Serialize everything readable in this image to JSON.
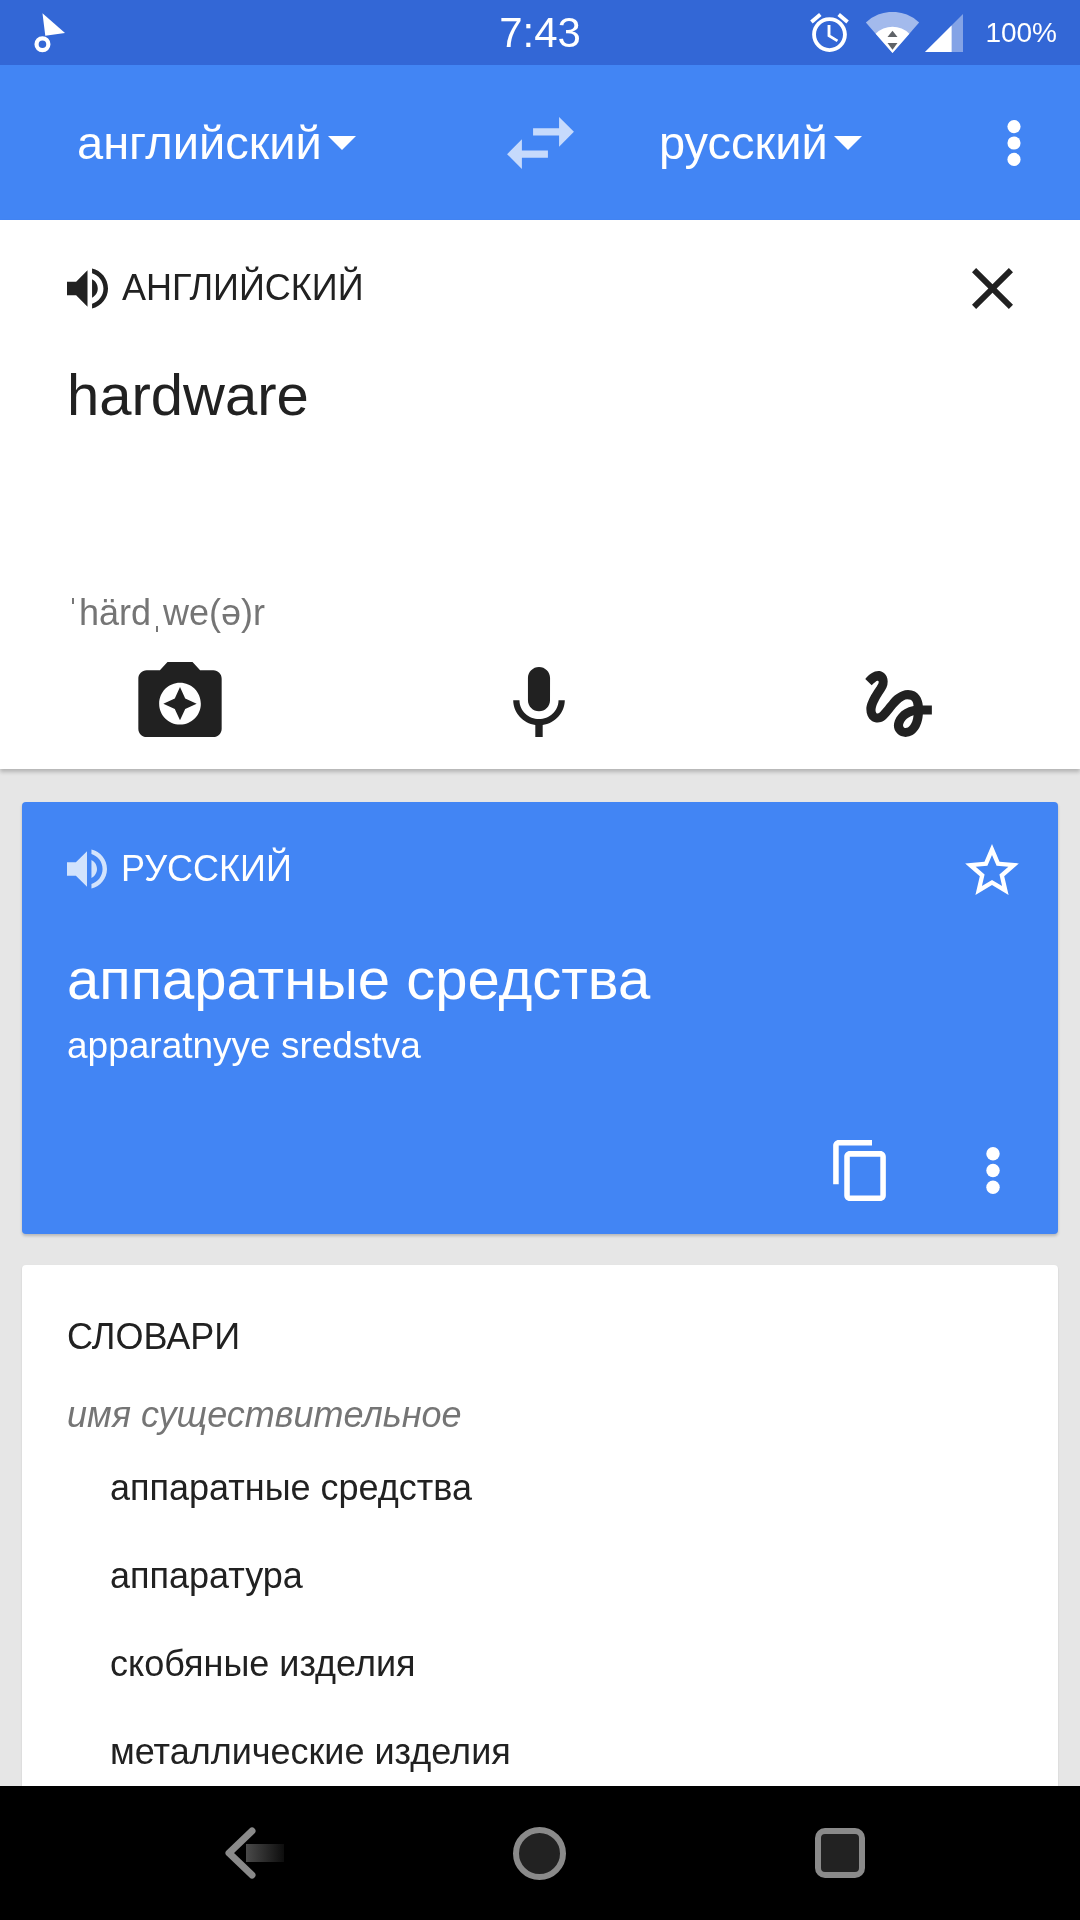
{
  "status_bar": {
    "time": "7:43",
    "battery": "100%"
  },
  "app_bar": {
    "source_language": "английский",
    "target_language": "русский"
  },
  "input": {
    "language": "АНГЛИЙСКИЙ",
    "value": "hardware",
    "phonetic": "ˈhärdˌwe(ə)r"
  },
  "translation": {
    "language": "РУССКИЙ",
    "text": "аппаратные средства",
    "transliteration": "apparatnyye sredstva",
    "starred": false
  },
  "dictionary": {
    "title": "СЛОВАРИ",
    "groups": [
      {
        "part_of_speech": "имя существительное",
        "entries": [
          "аппаратные средства",
          "аппаратура",
          "скобяные изделия",
          "металлические изделия"
        ]
      }
    ]
  }
}
